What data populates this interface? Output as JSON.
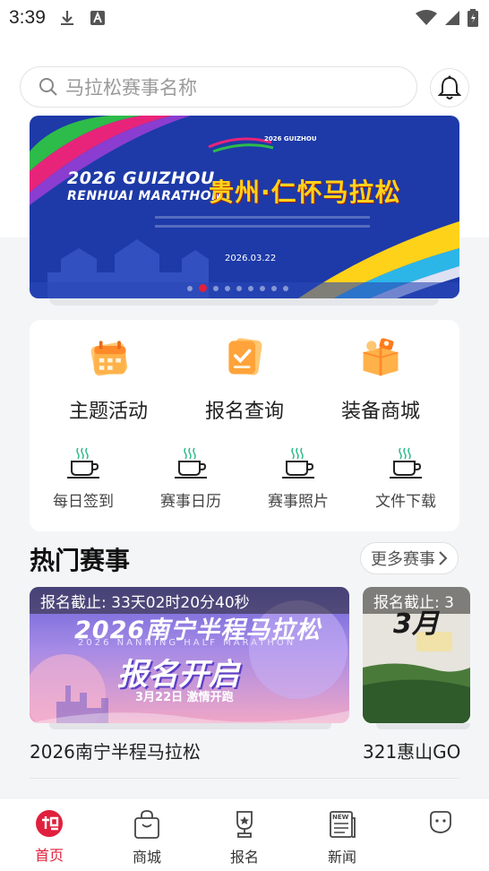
{
  "status_bar": {
    "time": "3:39"
  },
  "search": {
    "placeholder": "马拉松赛事名称"
  },
  "banner": {
    "logo_text": "2026 GUIZHOU",
    "title_en_line1": "2026 GUIZHOU",
    "title_en_line2": "RENHUAI MARATHON",
    "title_zh": "贵州·仁怀马拉松",
    "date": "2026.03.22",
    "slide_count": 9,
    "active_slide": 1
  },
  "menu": {
    "big_items": [
      {
        "label": "主题活动",
        "icon": "calendar-icon"
      },
      {
        "label": "报名查询",
        "icon": "checklist-icon"
      },
      {
        "label": "装备商城",
        "icon": "gift-box-icon"
      }
    ],
    "small_items": [
      {
        "label": "每日签到",
        "icon": "coffee-cup-icon"
      },
      {
        "label": "赛事日历",
        "icon": "coffee-cup-icon"
      },
      {
        "label": "赛事照片",
        "icon": "coffee-cup-icon"
      },
      {
        "label": "文件下载",
        "icon": "coffee-cup-icon"
      }
    ]
  },
  "hot_events": {
    "title": "热门赛事",
    "more_label": "更多赛事",
    "events": [
      {
        "deadline": "报名截止:  33天02时20分40秒",
        "poster_title": "2026南宁半程马拉松",
        "poster_subtitle": "2026 NANNING HALF MARATHON",
        "poster_headline": "报名开启",
        "poster_date": "3月22日 激情开跑",
        "name": "2026南宁半程马拉松"
      },
      {
        "deadline": "报名截止:  3",
        "poster_title": "3月",
        "name": "321惠山GO"
      }
    ]
  },
  "bottom_nav": [
    {
      "label": "首页",
      "icon": "home-logo-icon",
      "active": true
    },
    {
      "label": "商城",
      "icon": "shopping-bag-icon",
      "active": false
    },
    {
      "label": "报名",
      "icon": "trophy-icon",
      "active": false
    },
    {
      "label": "新闻",
      "icon": "news-icon",
      "active": false
    }
  ],
  "colors": {
    "accent": "#e0203c",
    "banner_blue": "#1d3aa8",
    "banner_gold": "#ffd21a"
  }
}
